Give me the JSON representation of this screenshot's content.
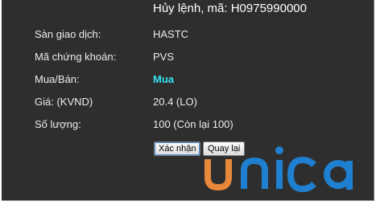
{
  "header": {
    "title": "Hủy lệnh, mã: H0975990000"
  },
  "order": {
    "rows": [
      {
        "label": "Sàn giao dịch:",
        "value": "HASTC"
      },
      {
        "label": "Mã chứng khoán:",
        "value": "PVS"
      },
      {
        "label": "Mua/Bán:",
        "value": "Mua"
      },
      {
        "label": "Giá:  (KVND)",
        "value": "20.4  (LO)"
      },
      {
        "label": "Số lượng:",
        "value": "100   (Còn lại 100)"
      }
    ]
  },
  "buttons": {
    "confirm_label": "Xác nhận",
    "back_label": "Quay lại"
  },
  "watermark": {
    "text": "unica",
    "colors": {
      "u": "#e7883a",
      "nica": "#1f7fd0"
    }
  },
  "colors": {
    "panel_bg": "#2e2e2e",
    "text": "#ececec",
    "buy_accent": "#33e0ee"
  }
}
